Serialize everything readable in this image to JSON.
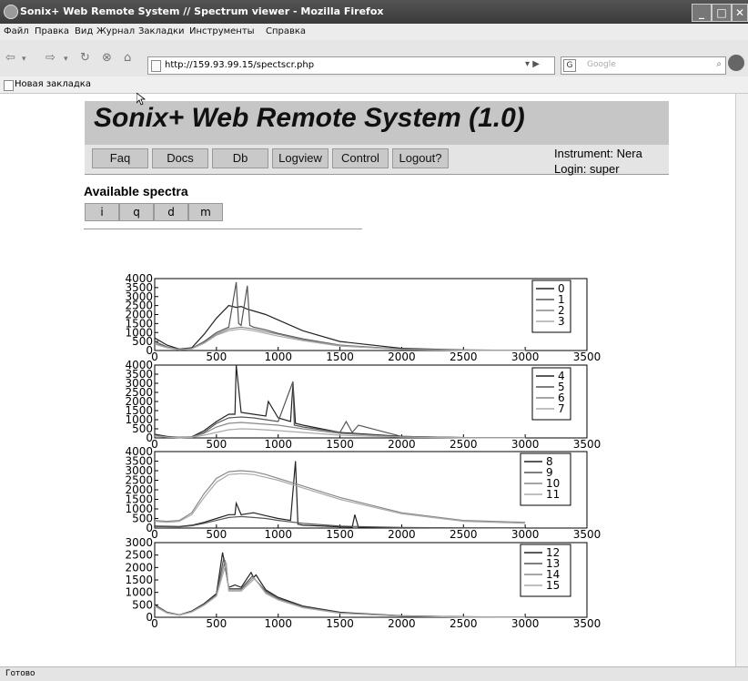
{
  "window": {
    "title": "Sonix+ Web Remote System // Spectrum viewer - Mozilla Firefox"
  },
  "menu": [
    "Файл",
    "Правка",
    "Вид",
    "Журнал",
    "Закладки",
    "Инструменты",
    "Справка"
  ],
  "address": {
    "url": "http://159.93.99.15/spectscr.php",
    "search_placeholder": "Google"
  },
  "bookmarks": {
    "item": "Новая закладка"
  },
  "site": {
    "title": "Sonix+ Web Remote System (1.0)",
    "nav": [
      "Faq",
      "Docs",
      "Db",
      "Logview",
      "Control",
      "Logout?"
    ],
    "instrument": "Instrument: Nera",
    "login": "Login: super",
    "available_title": "Available spectra",
    "spectra_buttons": [
      "i",
      "q",
      "d",
      "m"
    ]
  },
  "status": {
    "text": "Готово"
  },
  "colors": {
    "header_bg": "#c6c6c6",
    "button_bg": "#c9c9c9"
  },
  "chart_data": [
    {
      "type": "line",
      "xlim": [
        0,
        3500
      ],
      "ylim": [
        0,
        4000
      ],
      "xticks": [
        0,
        500,
        1000,
        1500,
        2000,
        2500,
        3000,
        3500
      ],
      "yticks": [
        0,
        500,
        1000,
        1500,
        2000,
        2500,
        3000,
        3500,
        4000
      ],
      "legend_position": "top-right",
      "series": [
        {
          "name": "0",
          "color": "#222222",
          "x": [
            0,
            100,
            200,
            300,
            400,
            500,
            600,
            660,
            700,
            750,
            800,
            900,
            1000,
            1200,
            1500,
            2000,
            2500,
            3000
          ],
          "y": [
            700,
            300,
            80,
            150,
            900,
            1800,
            2500,
            2400,
            2450,
            2300,
            2200,
            2000,
            1700,
            1100,
            500,
            120,
            30,
            10
          ]
        },
        {
          "name": "1",
          "color": "#555555",
          "x": [
            0,
            100,
            200,
            300,
            400,
            500,
            600,
            660,
            680,
            700,
            750,
            770,
            800,
            900,
            1000,
            1200,
            1500,
            2000,
            2500,
            3000
          ],
          "y": [
            500,
            200,
            60,
            120,
            500,
            1000,
            1300,
            3800,
            1500,
            1400,
            3600,
            1400,
            1300,
            1150,
            950,
            650,
            300,
            80,
            20,
            5
          ]
        },
        {
          "name": "2",
          "color": "#888888",
          "x": [
            0,
            100,
            200,
            300,
            400,
            500,
            600,
            700,
            800,
            900,
            1000,
            1200,
            1500,
            2000,
            2500,
            3000
          ],
          "y": [
            400,
            180,
            50,
            100,
            450,
            900,
            1200,
            1300,
            1200,
            1050,
            900,
            600,
            280,
            70,
            15,
            5
          ]
        },
        {
          "name": "3",
          "color": "#aaaaaa",
          "x": [
            0,
            100,
            200,
            300,
            400,
            500,
            600,
            700,
            800,
            900,
            1000,
            1200,
            1500,
            2000,
            2500,
            3000
          ],
          "y": [
            350,
            150,
            40,
            90,
            400,
            850,
            1100,
            1200,
            1100,
            950,
            800,
            550,
            250,
            60,
            10,
            5
          ]
        }
      ]
    },
    {
      "type": "line",
      "xlim": [
        0,
        3500
      ],
      "ylim": [
        0,
        4000
      ],
      "xticks": [
        0,
        500,
        1000,
        1500,
        2000,
        2500,
        3000,
        3500
      ],
      "yticks": [
        0,
        500,
        1000,
        1500,
        2000,
        2500,
        3000,
        3500,
        4000
      ],
      "legend_position": "top-right",
      "series": [
        {
          "name": "4",
          "color": "#222222",
          "x": [
            0,
            100,
            200,
            300,
            400,
            500,
            600,
            650,
            660,
            700,
            800,
            900,
            920,
            1000,
            1100,
            1120,
            1140,
            1200,
            1500,
            2000,
            2500,
            3000
          ],
          "y": [
            200,
            80,
            30,
            60,
            400,
            900,
            1300,
            1300,
            4000,
            1400,
            1300,
            1200,
            2000,
            1100,
            900,
            3000,
            800,
            700,
            300,
            80,
            20,
            5
          ]
        },
        {
          "name": "5",
          "color": "#555555",
          "x": [
            0,
            100,
            200,
            300,
            400,
            500,
            600,
            700,
            800,
            900,
            1000,
            1120,
            1130,
            1200,
            1500,
            1550,
            1600,
            1650,
            2000,
            2500,
            3000
          ],
          "y": [
            150,
            60,
            20,
            50,
            300,
            800,
            1100,
            1150,
            1100,
            1000,
            900,
            3100,
            700,
            600,
            300,
            900,
            300,
            700,
            80,
            20,
            5
          ]
        },
        {
          "name": "6",
          "color": "#888888",
          "x": [
            0,
            100,
            200,
            300,
            400,
            500,
            600,
            700,
            800,
            1000,
            1200,
            1500,
            2000,
            2500,
            3000
          ],
          "y": [
            120,
            50,
            20,
            40,
            250,
            600,
            800,
            850,
            800,
            700,
            500,
            250,
            60,
            15,
            5
          ]
        },
        {
          "name": "7",
          "color": "#aaaaaa",
          "x": [
            0,
            100,
            200,
            300,
            400,
            500,
            600,
            700,
            800,
            1000,
            1200,
            1500,
            2000,
            2500,
            3000
          ],
          "y": [
            100,
            40,
            15,
            30,
            150,
            300,
            450,
            500,
            480,
            400,
            300,
            150,
            40,
            10,
            5
          ]
        }
      ]
    },
    {
      "type": "line",
      "xlim": [
        0,
        3500
      ],
      "ylim": [
        0,
        4000
      ],
      "xticks": [
        0,
        500,
        1000,
        1500,
        2000,
        2500,
        3000,
        3500
      ],
      "yticks": [
        0,
        500,
        1000,
        1500,
        2000,
        2500,
        3000,
        3500,
        4000
      ],
      "legend_position": "top-right",
      "series": [
        {
          "name": "8",
          "color": "#222222",
          "x": [
            0,
            200,
            300,
            400,
            500,
            600,
            650,
            660,
            700,
            800,
            900,
            1000,
            1100,
            1140,
            1160,
            1200,
            1500,
            1600,
            1620,
            1650,
            2000,
            2500,
            3000
          ],
          "y": [
            100,
            80,
            150,
            300,
            500,
            700,
            700,
            1300,
            700,
            800,
            650,
            500,
            400,
            3500,
            200,
            150,
            60,
            50,
            700,
            40,
            20,
            10,
            5
          ]
        },
        {
          "name": "9",
          "color": "#555555",
          "x": [
            0,
            200,
            300,
            400,
            500,
            600,
            700,
            800,
            900,
            1000,
            1200,
            1500,
            2000,
            2500,
            3000
          ],
          "y": [
            80,
            60,
            120,
            250,
            400,
            550,
            600,
            550,
            500,
            400,
            250,
            100,
            30,
            10,
            5
          ]
        },
        {
          "name": "10",
          "color": "#888888",
          "x": [
            0,
            100,
            200,
            300,
            400,
            500,
            600,
            700,
            800,
            900,
            1000,
            1200,
            1500,
            2000,
            2500,
            3000
          ],
          "y": [
            400,
            350,
            400,
            800,
            1800,
            2600,
            2950,
            3000,
            2950,
            2800,
            2600,
            2200,
            1600,
            800,
            400,
            300
          ]
        },
        {
          "name": "11",
          "color": "#aaaaaa",
          "x": [
            0,
            100,
            200,
            300,
            400,
            500,
            600,
            700,
            800,
            1000,
            1200,
            1500,
            2000,
            2500,
            3000
          ],
          "y": [
            350,
            300,
            350,
            700,
            1600,
            2400,
            2800,
            2850,
            2800,
            2500,
            2100,
            1500,
            750,
            350,
            250
          ]
        }
      ]
    },
    {
      "type": "line",
      "xlim": [
        0,
        3500
      ],
      "ylim": [
        0,
        3000
      ],
      "xticks": [
        0,
        500,
        1000,
        1500,
        2000,
        2500,
        3000,
        3500
      ],
      "yticks": [
        0,
        500,
        1000,
        1500,
        2000,
        2500,
        3000
      ],
      "legend_position": "top-right",
      "series": [
        {
          "name": "12",
          "color": "#222222",
          "x": [
            0,
            100,
            200,
            300,
            400,
            500,
            550,
            600,
            650,
            700,
            780,
            800,
            820,
            900,
            1000,
            1200,
            1500,
            2000,
            2500,
            3000
          ],
          "y": [
            500,
            200,
            100,
            250,
            550,
            950,
            2600,
            1200,
            1300,
            1200,
            1800,
            1600,
            1700,
            1100,
            800,
            450,
            200,
            60,
            20,
            5
          ]
        },
        {
          "name": "13",
          "color": "#555555",
          "x": [
            0,
            100,
            200,
            300,
            400,
            500,
            560,
            600,
            700,
            790,
            900,
            1000,
            1200,
            1500,
            2000,
            2500,
            3000
          ],
          "y": [
            480,
            190,
            90,
            230,
            520,
            900,
            2400,
            1150,
            1150,
            1650,
            1050,
            750,
            420,
            180,
            55,
            18,
            5
          ]
        },
        {
          "name": "14",
          "color": "#888888",
          "x": [
            0,
            100,
            200,
            300,
            400,
            500,
            570,
            600,
            700,
            800,
            900,
            1000,
            1200,
            1500,
            2000,
            2500,
            3000
          ],
          "y": [
            460,
            180,
            90,
            220,
            500,
            880,
            2300,
            1100,
            1100,
            1600,
            1000,
            720,
            400,
            170,
            50,
            15,
            5
          ]
        },
        {
          "name": "15",
          "color": "#aaaaaa",
          "x": [
            0,
            100,
            200,
            300,
            400,
            500,
            580,
            600,
            700,
            810,
            900,
            1000,
            1200,
            1500,
            2000,
            2500,
            3000
          ],
          "y": [
            440,
            170,
            85,
            210,
            480,
            850,
            2200,
            1050,
            1050,
            1550,
            950,
            700,
            380,
            160,
            45,
            12,
            5
          ]
        }
      ]
    }
  ]
}
